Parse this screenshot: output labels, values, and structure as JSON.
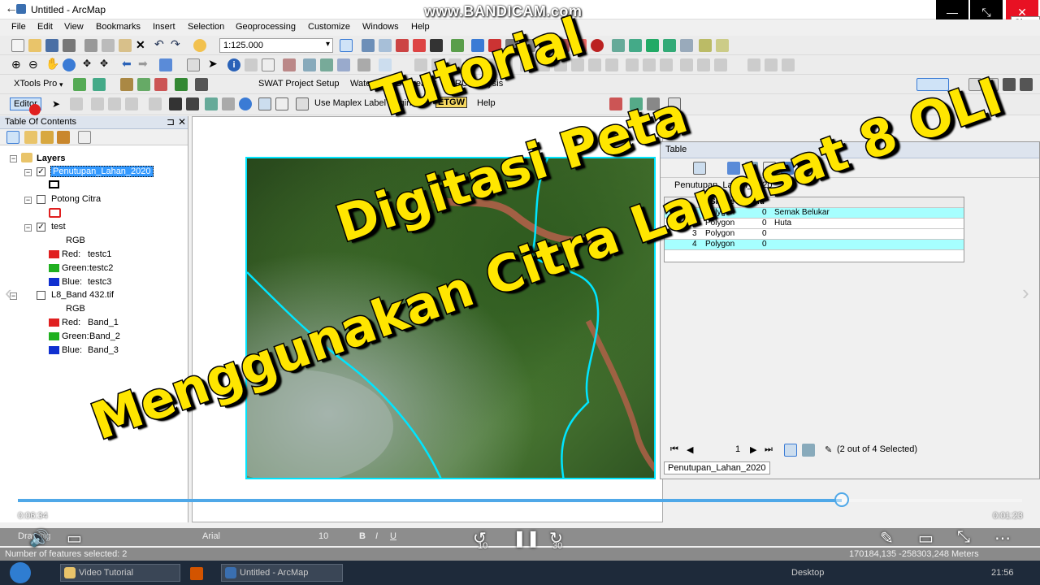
{
  "window": {
    "title": "Untitled - ArcMap",
    "watermark": "www.BANDICAM.com",
    "close_tooltip": "Close"
  },
  "menu": [
    "File",
    "Edit",
    "View",
    "Bookmarks",
    "Insert",
    "Selection",
    "Geoprocessing",
    "Customize",
    "Windows",
    "Help"
  ],
  "toolbar": {
    "scale": "1:125.000",
    "xtools": "XTools Pro",
    "swat": "SWAT Project Setup",
    "watershed": "Watershed Delineator",
    "hru": "HRU Analysis",
    "editor": "Editor",
    "maplex": "Use Maplex Label Engine",
    "etgw": "ETGW",
    "help": "Help"
  },
  "toc": {
    "title": "Table Of Contents",
    "root": "Layers",
    "layers": [
      {
        "name": "Penutupan_Lahan_2020",
        "checked": true,
        "selected": true
      },
      {
        "name": "Potong Citra",
        "checked": false
      },
      {
        "name": "test",
        "checked": true,
        "rgb": "RGB",
        "bands": [
          {
            "label": "Red:",
            "value": "testc1"
          },
          {
            "label": "Green:",
            "value": "testc2"
          },
          {
            "label": "Blue:",
            "value": "testc3"
          }
        ]
      },
      {
        "name": "L8_Band 432.tif",
        "checked": false,
        "rgb": "RGB",
        "bands": [
          {
            "label": "Red:",
            "value": "Band_1"
          },
          {
            "label": "Green:",
            "value": "Band_2"
          },
          {
            "label": "Blue:",
            "value": "Band_3"
          }
        ]
      }
    ]
  },
  "table": {
    "title": "Table",
    "tab_top": "Penutupan_Lahan_2020",
    "headers": [
      "Shape *",
      "Id"
    ],
    "rows": [
      {
        "fid": "0",
        "shape": "Polygon",
        "id": "0",
        "extra": "Semak Belukar"
      },
      {
        "fid": "1",
        "shape": "Polygon",
        "id": "0",
        "extra": "Huta"
      },
      {
        "fid": "3",
        "shape": "Polygon",
        "id": "0",
        "extra": ""
      },
      {
        "fid": "4",
        "shape": "Polygon",
        "id": "0",
        "extra": ""
      }
    ],
    "record": "1",
    "selection_info": "(2 out of 4 Selected)",
    "tab_bottom": "Penutupan_Lahan_2020"
  },
  "overlay": {
    "line1": "Tutorial",
    "line2": "Digitasi Peta",
    "line3": "Menggunakan Citra Landsat 8 OLI"
  },
  "video": {
    "elapsed": "0:06:34",
    "remaining": "0:01:23",
    "progress": 0.82,
    "rewind_seconds": "10",
    "forward_seconds": "30"
  },
  "drawing": {
    "label": "Drawing",
    "font": "Arial",
    "size": "10",
    "bold": "B",
    "italic": "I",
    "underline": "U"
  },
  "status": {
    "features": "Number of features selected: 2",
    "coords": "170184,135  -258303,248 Meters"
  },
  "taskbar": {
    "items": [
      "Video Tutorial",
      "Untitled - ArcMap"
    ],
    "desktop": "Desktop",
    "clock": "21:56"
  },
  "colors": {
    "overlay_text": "#ffe600",
    "selection_row": "#a6ffff",
    "polygon_outline": "#00e5ff",
    "close_button": "#e81123"
  }
}
